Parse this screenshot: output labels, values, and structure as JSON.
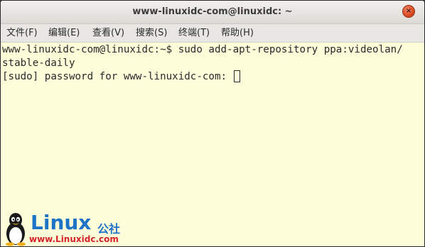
{
  "window": {
    "title": "www-linuxidc-com@linuxidc: ~",
    "close_glyph": "×"
  },
  "menu": {
    "items": [
      {
        "label": "文件(F)"
      },
      {
        "label": "编辑(E)"
      },
      {
        "label": "查看(V)"
      },
      {
        "label": "搜索(S)"
      },
      {
        "label": "终端(T)"
      },
      {
        "label": "帮助(H)"
      }
    ]
  },
  "terminal": {
    "lines": [
      "www-linuxidc-com@linuxidc:~$ sudo add-apt-repository ppa:videolan/",
      "stable-daily",
      "[sudo] password for www-linuxidc-com: "
    ],
    "background": "#fdfdda",
    "foreground": "#2a2a2a"
  },
  "watermark": {
    "brand": "Linux",
    "brand_cn": "公社",
    "url": "www.Linuxidc.com"
  },
  "colors": {
    "accent_close": "#d9461f",
    "watermark_blue": "#1d74c6",
    "watermark_red": "#d4232b"
  }
}
